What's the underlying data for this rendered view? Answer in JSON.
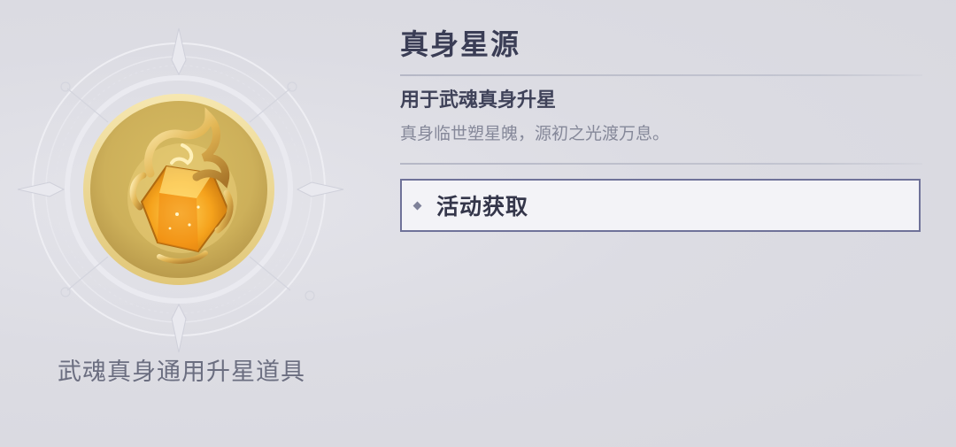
{
  "item": {
    "name": "真身星源",
    "usage": "用于武魂真身升星",
    "description": "真身临世塑星魄，源初之光渡万息。",
    "caption": "武魂真身通用升星道具",
    "icon": "golden-crystal-icon"
  },
  "sources": [
    {
      "label": "活动获取"
    }
  ],
  "colors": {
    "background": "#dcdce3",
    "title": "#3a3d55",
    "button_border": "#6f7299",
    "medallion_gold": "#e6c86a"
  }
}
